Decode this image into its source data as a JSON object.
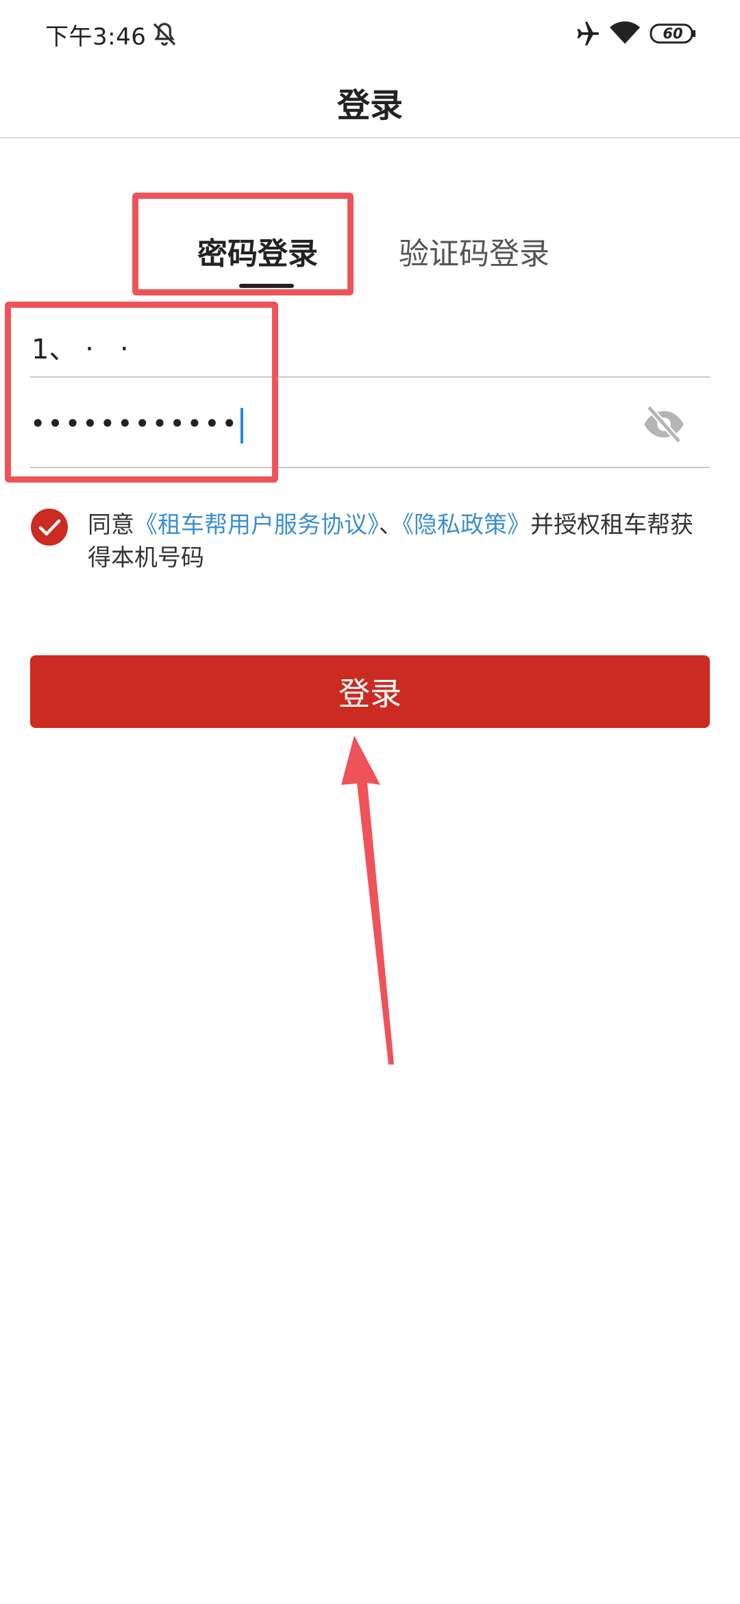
{
  "status_bar": {
    "time": "下午3:46",
    "battery": "60",
    "icons": [
      "bell-muted-icon",
      "airplane-icon",
      "wifi-icon",
      "battery-icon"
    ]
  },
  "header": {
    "title": "登录"
  },
  "tabs": [
    {
      "label": "密码登录",
      "active": true
    },
    {
      "label": "验证码登录",
      "active": false
    }
  ],
  "form": {
    "phone_value": "1、 ‧   ‧  ",
    "password_masked": "••••••••••••",
    "eye_icon": "eye-off-icon"
  },
  "agreement": {
    "checked": true,
    "prefix": "同意",
    "link_terms": "《租车帮用户服务协议》",
    "separator": "、",
    "link_privacy": "《隐私政策》",
    "suffix": "并授权租车帮获得本机号码"
  },
  "login_button": {
    "label": "登录"
  },
  "colors": {
    "primary": "#cc2b22",
    "link": "#3b8fd1",
    "annotation": "#f0525a",
    "caret": "#1e88e5"
  }
}
